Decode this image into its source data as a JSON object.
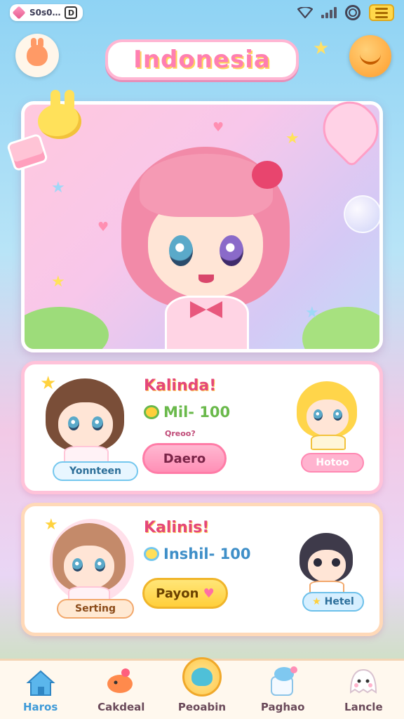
{
  "status_bar": {
    "left_text": "S0s0…",
    "left_badge": "D"
  },
  "header": {
    "title": "Indonesia"
  },
  "cards": [
    {
      "name": "Kalinda!",
      "stat": "Mil- 100",
      "sub": "Qreoo?",
      "button": "Daero",
      "left_tag": "Yonnteen",
      "right_tag": "Hotoo"
    },
    {
      "name": "Kalinis!",
      "stat": "Inshil- 100",
      "button": "Payon",
      "left_tag": "Serting",
      "right_tag": "Hetel"
    }
  ],
  "nav": [
    {
      "label": "Haros",
      "icon": "home-icon"
    },
    {
      "label": "Cakdeal",
      "icon": "fish-icon"
    },
    {
      "label": "Peoabin",
      "icon": "center-creature-icon"
    },
    {
      "label": "Paghao",
      "icon": "jar-icon"
    },
    {
      "label": "Lancle",
      "icon": "ghost-icon"
    }
  ],
  "colors": {
    "accent_pink": "#ff7fb1",
    "accent_blue": "#3e9ad8",
    "accent_yellow": "#ffd84a"
  }
}
